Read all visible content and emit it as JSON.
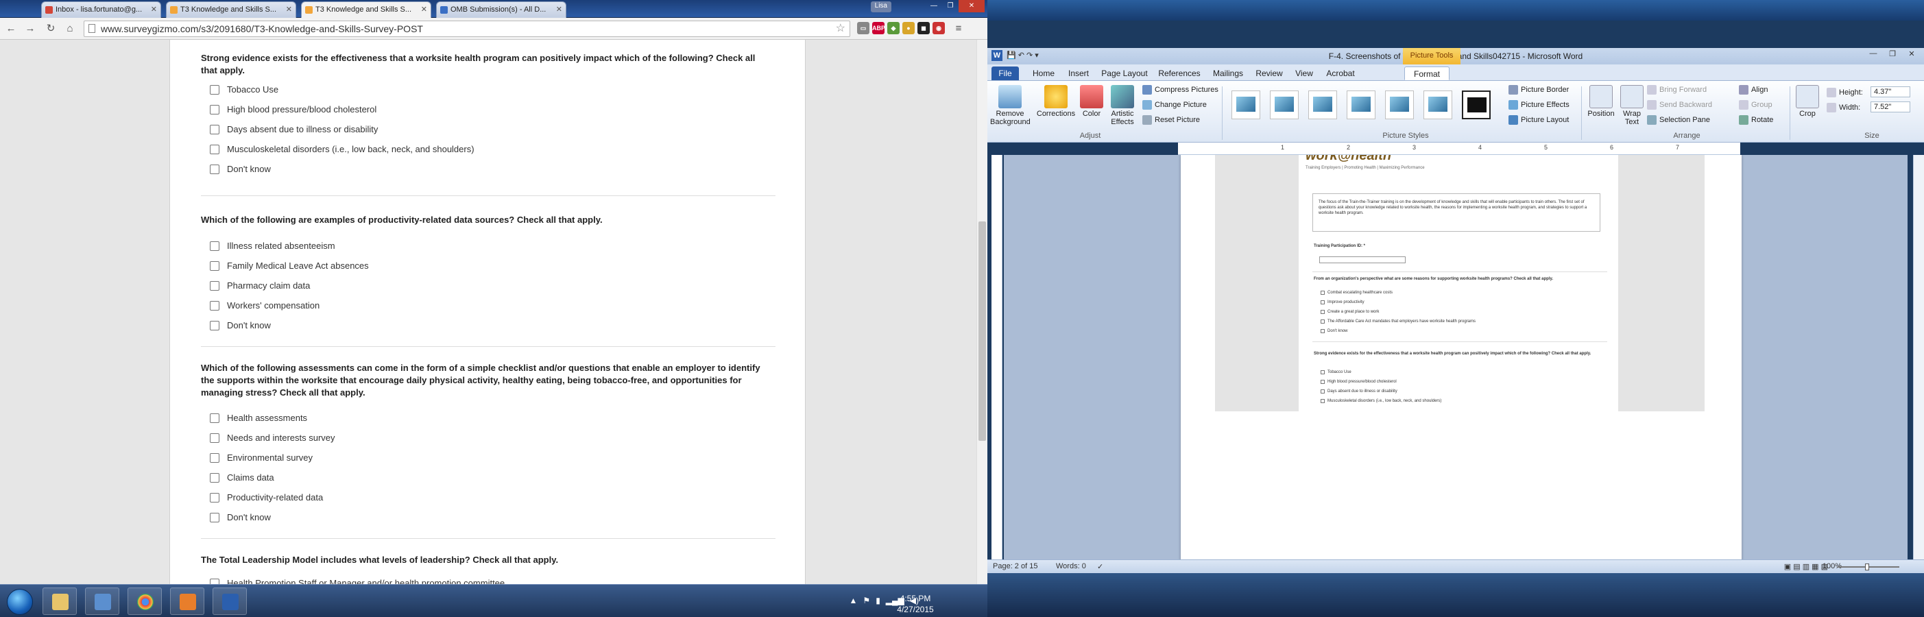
{
  "browser": {
    "tabs": [
      {
        "label": "Inbox - lisa.fortunato@g...",
        "active": false,
        "favicon_color": "#d44638"
      },
      {
        "label": "T3 Knowledge and Skills S...",
        "active": false,
        "favicon_color": "#f2a63b"
      },
      {
        "label": "T3 Knowledge and Skills S...",
        "active": true,
        "favicon_color": "#f2a63b"
      },
      {
        "label": "OMB Submission(s) - All D...",
        "active": false,
        "favicon_color": "#3a6fc4"
      }
    ],
    "user": "Lisa",
    "url": "www.surveygizmo.com/s3/2091680/T3-Knowledge-and-Skills-Survey-POST"
  },
  "survey": {
    "questions": [
      {
        "text": "Strong evidence exists for the effectiveness that a worksite health program can positively impact which of the following? Check all that apply.",
        "options": [
          "Tobacco Use",
          "High blood pressure/blood cholesterol",
          "Days absent due to illness or disability",
          "Musculoskeletal disorders (i.e., low back, neck, and shoulders)",
          "Don't know"
        ]
      },
      {
        "text": "Which of the following are examples of productivity-related data sources?  Check all that apply.",
        "options": [
          "Illness related absenteeism",
          "Family Medical Leave Act absences",
          "Pharmacy claim data",
          "Workers' compensation",
          "Don't know"
        ]
      },
      {
        "text": "Which of the following assessments can come in the form of a simple checklist and/or questions that enable an employer to identify the supports within the worksite that encourage daily physical activity, healthy eating, being tobacco-free, and opportunities for managing stress? Check all that apply.",
        "options": [
          "Health assessments",
          "Needs and interests survey",
          "Environmental survey",
          "Claims data",
          "Productivity-related data",
          "Don't know"
        ]
      },
      {
        "text": "The Total Leadership Model includes what levels of leadership? Check all that apply.",
        "options": [
          "Health Promotion Staff or Manager and/or health promotion committee"
        ]
      }
    ]
  },
  "taskbar": {
    "time": "4:55 PM",
    "date": "4/27/2015"
  },
  "word": {
    "title": "F-4. Screenshots of T3 Knowledge and Skills042715  -  Microsoft Word",
    "context_tab": "Picture Tools",
    "tabs": [
      "File",
      "Home",
      "Insert",
      "Page Layout",
      "References",
      "Mailings",
      "Review",
      "View",
      "Acrobat",
      "Format"
    ],
    "ribbon": {
      "remove_background": "Remove Background",
      "corrections": "Corrections",
      "color": "Color",
      "artistic_effects": "Artistic Effects",
      "compress": "Compress Pictures",
      "change": "Change Picture",
      "reset": "Reset Picture",
      "adjust_label": "Adjust",
      "picture_styles_label": "Picture Styles",
      "picture_border": "Picture Border",
      "picture_effects": "Picture Effects",
      "picture_layout": "Picture Layout",
      "position": "Position",
      "wrap_text": "Wrap Text",
      "bring_forward": "Bring Forward",
      "send_backward": "Send Backward",
      "selection_pane": "Selection Pane",
      "align": "Align",
      "group": "Group",
      "rotate": "Rotate",
      "arrange_label": "Arrange",
      "crop": "Crop",
      "height_label": "Height:",
      "height_value": "4.37\"",
      "width_label": "Width:",
      "width_value": "7.52\"",
      "size_label": "Size"
    },
    "embedded": {
      "logo": "work@health",
      "logo_sub": "Training Employers | Promoting Health | Maximizing Performance",
      "intro": "The focus of the Train-the-Trainer training is on the development of knowledge and skills that will enable participants to train others. The first set of questions ask about your knowledge related to worksite health, the reasons for implementing a worksite health program, and strategies to support a worksite health program.",
      "participation_label": "Training Participation ID: *",
      "q1": "From an organization's perspective what are some reasons for supporting worksite health programs? Check all that apply.",
      "q1_options": [
        "Combat escalating healthcare costs",
        "Improve productivity",
        "Create a great place to work",
        "The Affordable Care Act mandates that employers have worksite health programs",
        "Don't know"
      ],
      "q2": "Strong evidence exists for the effectiveness that a worksite health program can positively impact which of the following? Check all that apply.",
      "q2_options": [
        "Tobacco Use",
        "High blood pressure/blood cholesterol",
        "Days absent due to illness or disability",
        "Musculoskeletal disorders (i.e., low back, neck, and shoulders)"
      ]
    },
    "status": {
      "page": "Page: 2 of 15",
      "words": "Words: 0",
      "zoom": "100%"
    }
  }
}
